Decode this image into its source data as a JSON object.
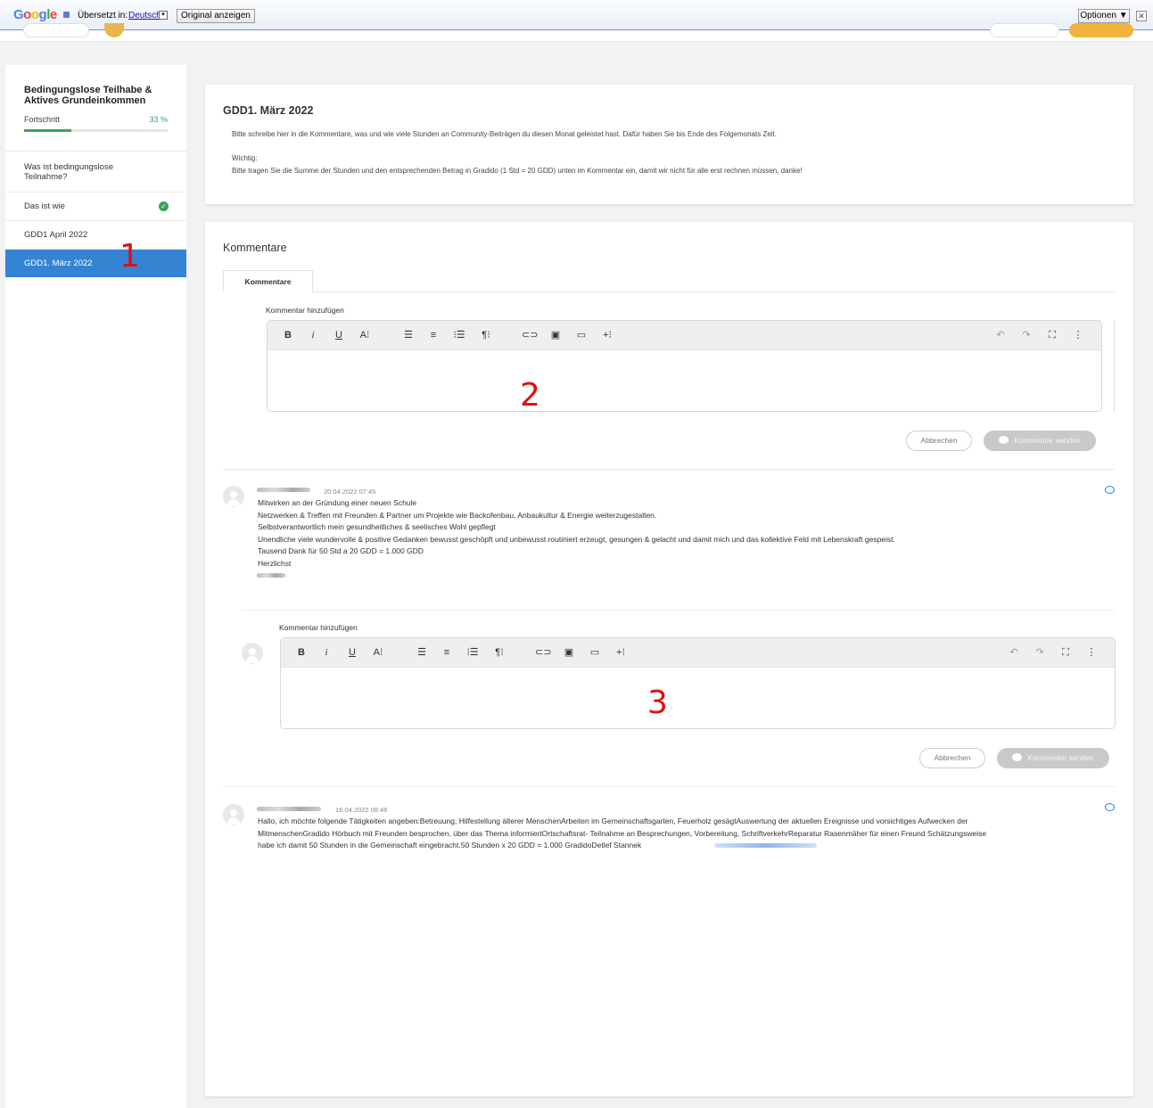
{
  "translate_bar": {
    "logo_letters": [
      "G",
      "o",
      "o",
      "g",
      "l",
      "e"
    ],
    "translated_label": "Übersetzt in:",
    "language": "Deutsch",
    "language_dropdown": "▾",
    "original_button": "Original anzeigen",
    "options_button": "Optionen ▼",
    "close": "✕"
  },
  "sidebar": {
    "course_title": "Bedingungslose Teilhabe & Aktives Grundeinkommen",
    "progress_label": "Fortschritt",
    "progress_pct_text": "33 %",
    "progress_fraction": 0.33,
    "items": [
      {
        "label": "Was ist bedingungslose Teilnahme?",
        "completed": false,
        "active": false
      },
      {
        "label": "Das ist wie",
        "completed": true,
        "active": false
      },
      {
        "label": "GDD1 April 2022",
        "completed": false,
        "active": false
      },
      {
        "label": "GDD1. März 2022",
        "completed": false,
        "active": true
      }
    ]
  },
  "annotations": [
    "1",
    "2",
    "3"
  ],
  "lesson": {
    "title": "GDD1. März 2022",
    "intro": "Bitte schreibe hier in die Kommentare, was und wie viele Stunden an Community-Beiträgen du diesen Monat geleistet hast. Dafür haben Sie bis Ende des Folgemonats Zeit.",
    "important_label": "Wichtig:",
    "important_text": "Bitte tragen Sie die Summe der Stunden und den entsprechenden Betrag in Gradido (1 Std = 20 GDD) unten im Kommentar ein, damit wir nicht für alle erst rechnen müssen, danke!"
  },
  "comments_section": {
    "title": "Kommentare",
    "tab_label": "Kommentare",
    "editor_label": "Kommentar hinzufügen",
    "cancel_label": "Abbrechen",
    "send_label": "Kommentar senden",
    "toolbar": {
      "bold": "B",
      "italic": "i",
      "underline": "U",
      "font_size": "A⁝",
      "align_left": "☰",
      "align_center": "≡",
      "ordered_list": "⁝☰",
      "paragraph": "¶⁝",
      "link": "⊂⊃",
      "image": "▣",
      "video": "▭",
      "insert_more": "+⁝",
      "undo": "↶",
      "redo": "↷",
      "fullscreen": "⛶",
      "more": "⋮"
    }
  },
  "comments": [
    {
      "time": "20.04.2022 07:45",
      "lines": [
        "Mitwirken an der Gründung einer neuen Schule",
        "Netzwerken & Treffen mit Freunden & Partner um Projekte wie Backofenbau, Anbaukultur & Energie weiterzugestalten.",
        "Selbstverantwortlich mein gesundheitliches & seelisches Wohl gepflegt",
        "Unendliche viele wundervolle & positive Gedanken bewusst geschöpft und unbewusst routiniert erzeugt, gesungen & gelacht und damit mich und das kollektive Feld mit Lebenskraft gespeist.",
        "Tausend Dank für 50 Std a 20 GDD = 1.000 GDD",
        "Herzlichst"
      ]
    },
    {
      "time": "16.04.2022 08:46",
      "lines": [
        "Hallo, ich möchte folgende Tätigkeiten angeben:Betreuung, Hilfestellung älterer MenschenArbeiten im Gemeinschaftsgarten, Feuerholz gesägtAuswertung der aktuellen Ereignisse und vorsichtiges Aufwecken der",
        "MitmenschenGradido Hörbuch mit Freunden besprochen, über das Thema informiertOrtschaftsrat- Teilnahme an Besprechungen, Vorbereitung, SchriftverkehrReparatur Rasenmäher für einen Freund Schätzungsweise",
        "habe ich damit 50 Stunden in die Gemeinschaft eingebracht.50 Stunden x 20 GDD = 1.000 GradidoDetlef Stannek"
      ]
    }
  ],
  "colors": {
    "accent_blue": "#3584d4",
    "progress_green": "#3aa35a",
    "annotation_red": "#e01010"
  }
}
